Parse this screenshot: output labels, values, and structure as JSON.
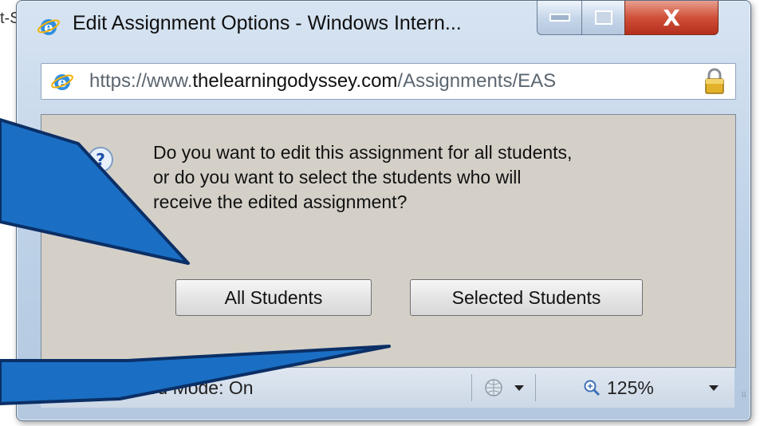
{
  "background": {
    "edge_text": "t-S"
  },
  "window": {
    "title": "Edit Assignment Options - Windows Intern...",
    "controls": {
      "minimize": "minimize",
      "maximize": "maximize",
      "close": "X"
    }
  },
  "address": {
    "scheme": "https://www.",
    "host": "thelearningodyssey.com",
    "path": "/Assignments/EAS"
  },
  "dialog": {
    "message_lines": [
      "Do you want to edit this assignment for all students,",
      "or do you want to select the students who will",
      "receive the edited assignment?"
    ],
    "buttons": {
      "all": "All Students",
      "selected": "Selected Students"
    }
  },
  "status": {
    "text": "net | Protected Mode: On",
    "zoom": "125%"
  },
  "icons": [
    "ie-logo-icon",
    "lock-icon",
    "question-icon",
    "globe-icon",
    "zoom-icon"
  ],
  "colors": {
    "callout_fill": "#1a6fc4",
    "callout_stroke": "#0b2f66",
    "close_button": "#d0503a",
    "dialog_bg": "#d4d0c8"
  }
}
